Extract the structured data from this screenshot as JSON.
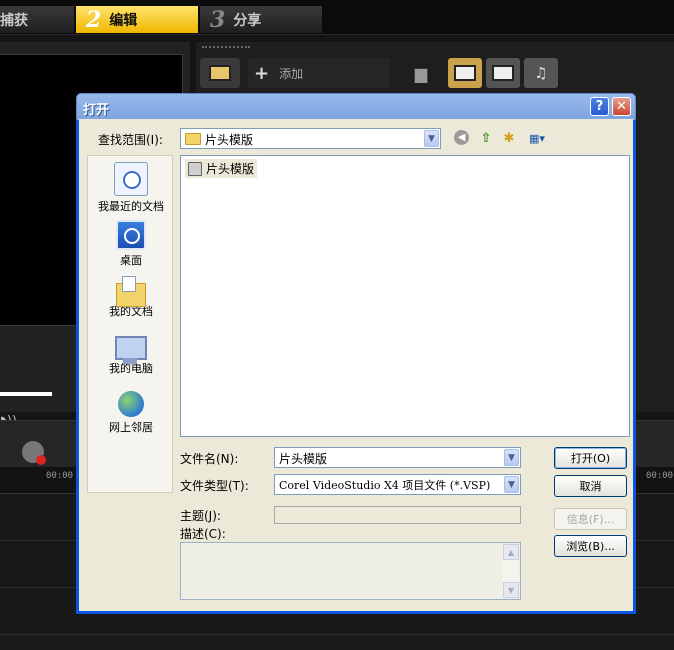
{
  "app": {
    "tabs": [
      {
        "num": "",
        "label": "捕获"
      },
      {
        "num": "2",
        "label": "编辑"
      },
      {
        "num": "3",
        "label": "分享"
      }
    ],
    "library": {
      "add_label": "添加"
    },
    "timeline": {
      "ruler_labels": [
        "00:00",
        "00:00"
      ]
    }
  },
  "dialog": {
    "title": "打开",
    "help_label": "?",
    "close_label": "✕",
    "lookin": {
      "label": "查找范围(I):",
      "value": "片头模版"
    },
    "places": [
      {
        "label": "我最近的文档"
      },
      {
        "label": "桌面"
      },
      {
        "label": "我的文档"
      },
      {
        "label": "我的电脑"
      },
      {
        "label": "网上邻居"
      }
    ],
    "files": [
      {
        "name": "片头模版"
      }
    ],
    "filename": {
      "label": "文件名(N):",
      "value": "片头模版"
    },
    "filetype": {
      "label": "文件类型(T):",
      "value": "Corel VideoStudio X4 项目文件 (*.VSP)"
    },
    "subject": {
      "label": "主题(J):",
      "value": ""
    },
    "description": {
      "label": "描述(C):",
      "value": ""
    },
    "buttons": {
      "open": "打开(O)",
      "cancel": "取消",
      "info": "信息(F)...",
      "browse": "浏览(B)..."
    }
  }
}
